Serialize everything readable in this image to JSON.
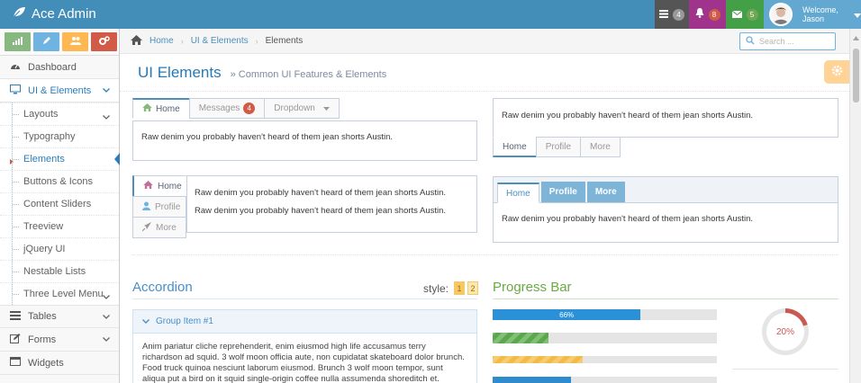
{
  "brand": {
    "name": "Ace Admin"
  },
  "navbar": {
    "tasks_count": "4",
    "notifications_count": "8",
    "messages_count": "5",
    "welcome": "Welcome,",
    "username": "Jason"
  },
  "sidebar": {
    "items": [
      {
        "label": "Dashboard"
      },
      {
        "label": "UI & Elements"
      },
      {
        "label": "Tables"
      },
      {
        "label": "Forms"
      },
      {
        "label": "Widgets"
      }
    ],
    "subitems": [
      "Layouts",
      "Typography",
      "Elements",
      "Buttons & Icons",
      "Content Sliders",
      "Treeview",
      "jQuery UI",
      "Nestable Lists",
      "Three Level Menu"
    ]
  },
  "breadcrumb": {
    "home": "Home",
    "section": "UI & Elements",
    "current": "Elements"
  },
  "search": {
    "placeholder": "Search ..."
  },
  "page": {
    "title": "UI Elements",
    "subtitle": "Common UI Features & Elements"
  },
  "tabs1": {
    "home": "Home",
    "messages": "Messages",
    "messages_badge": "4",
    "dropdown": "Dropdown",
    "content": "Raw denim you probably haven't heard of them jean shorts Austin."
  },
  "tabs2": {
    "content": "Raw denim you probably haven't heard of them jean shorts Austin.",
    "home": "Home",
    "profile": "Profile",
    "more": "More"
  },
  "tabs3": {
    "home": "Home",
    "profile": "Profile",
    "more": "More",
    "line1": "Raw denim you probably haven't heard of them jean shorts Austin.",
    "line2": "Raw denim you probably haven't heard of them jean shorts Austin."
  },
  "tabs4": {
    "home": "Home",
    "profile": "Profile",
    "more": "More",
    "content": "Raw denim you probably haven't heard of them jean shorts Austin."
  },
  "accordion": {
    "title": "Accordion",
    "style_label": "style:",
    "style1": "1",
    "style2": "2",
    "group1_title": "Group Item #1",
    "group1_text": "Anim pariatur cliche reprehenderit, enim eiusmod high life accusamus terry richardson ad squid. 3 wolf moon officia aute, non cupidatat skateboard dolor brunch. Food truck quinoa nesciunt laborum eiusmod. Brunch 3 wolf moon tempor, sunt aliqua put a bird on it squid single-origin coffee nulla assumenda shoreditch et."
  },
  "progress": {
    "title": "Progress Bar",
    "bar1_label": "66%",
    "bar1_value": 66,
    "bar2_value": 25,
    "bar3_value": 40,
    "bar4_value": 35,
    "donut_label": "20%",
    "donut_value": 20
  },
  "colors": {
    "navbar": "#438eb9",
    "primary": "#2b7dbc",
    "success": "#82af6f",
    "warning": "#f2bb46",
    "info": "#2e8bcc",
    "danger": "#ca5952"
  }
}
